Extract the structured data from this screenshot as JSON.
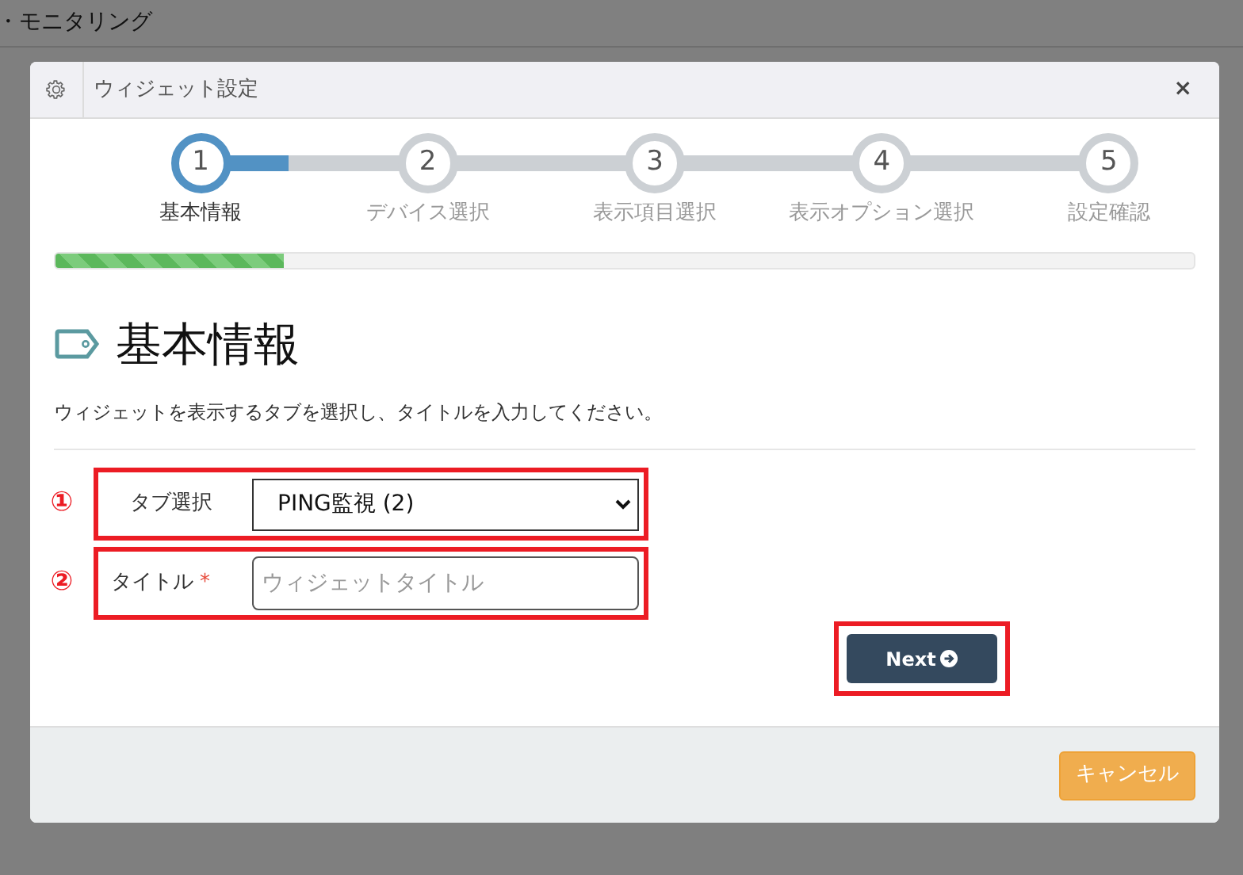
{
  "background": {
    "title": "・モニタリング"
  },
  "dialog": {
    "title": "ウィジェット設定",
    "close": "×",
    "steps": [
      {
        "number": "1",
        "label": "基本情報",
        "selected": true
      },
      {
        "number": "2",
        "label": "デバイス選択",
        "selected": false
      },
      {
        "number": "3",
        "label": "表示項目選択",
        "selected": false
      },
      {
        "number": "4",
        "label": "表示オプション選択",
        "selected": false
      },
      {
        "number": "5",
        "label": "設定確認",
        "selected": false
      }
    ],
    "progress": {
      "level": 0.2
    },
    "heading": "基本情報",
    "description": "ウィジェットを表示するタブを選択し、タイトルを入力してください。",
    "fields": [
      {
        "kind": "select",
        "marker": "①",
        "label": "タブ選択",
        "value": "PING監視 (2)",
        "highlighted": true
      },
      {
        "kind": "text",
        "marker": "②",
        "label": "タイトル",
        "placeholder": "ウィジェットタイトル",
        "required_mark": "*",
        "highlighted": true
      }
    ],
    "next_button": {
      "label": "Next",
      "highlighted": true
    },
    "cancel_button": {
      "label": "キャンセル"
    }
  }
}
